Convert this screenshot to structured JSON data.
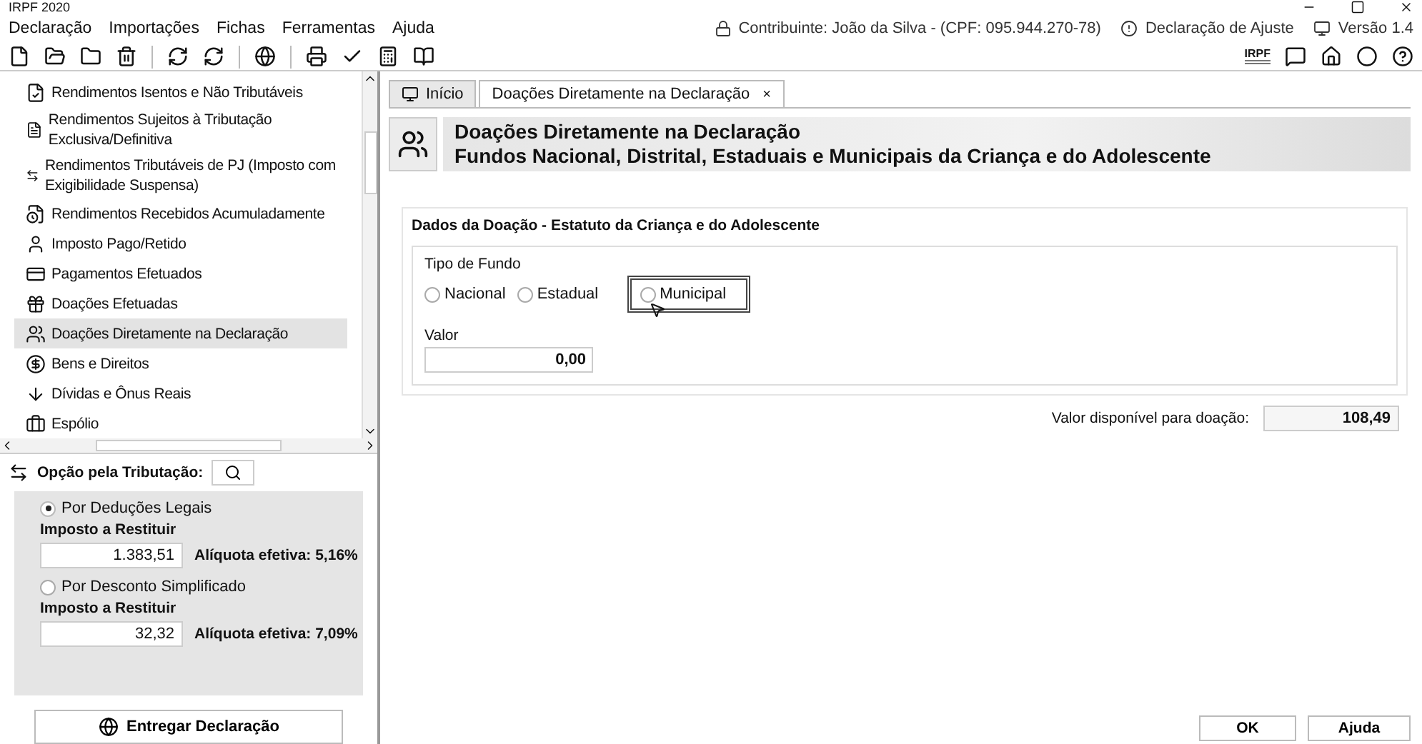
{
  "window": {
    "title": "IRPF 2020"
  },
  "menu": [
    "Declaração",
    "Importações",
    "Fichas",
    "Ferramentas",
    "Ajuda"
  ],
  "header_info": {
    "contribuinte": "Contribuinte: João da Silva - (CPF: 095.944.270-78)",
    "declaracao": "Declaração de Ajuste",
    "versao": "Versão 1.4"
  },
  "toolbar": {
    "logo": "IRPF"
  },
  "sidebar": {
    "items": [
      {
        "label": "Rendimentos Isentos e Não Tributáveis",
        "selected": false
      },
      {
        "label": "Rendimentos Sujeitos à Tributação Exclusiva/Definitiva",
        "selected": false
      },
      {
        "label": "Rendimentos Tributáveis de PJ (Imposto com Exigibilidade Suspensa)",
        "selected": false
      },
      {
        "label": "Rendimentos Recebidos Acumuladamente",
        "selected": false
      },
      {
        "label": "Imposto Pago/Retido",
        "selected": false
      },
      {
        "label": "Pagamentos Efetuados",
        "selected": false
      },
      {
        "label": "Doações Efetuadas",
        "selected": false
      },
      {
        "label": "Doações Diretamente na Declaração",
        "selected": true
      },
      {
        "label": "Bens e Direitos",
        "selected": false
      },
      {
        "label": "Dívidas e Ônus Reais",
        "selected": false
      },
      {
        "label": "Espólio",
        "selected": false
      }
    ]
  },
  "tax_option": {
    "label": "Opção pela Tributação:",
    "options": [
      {
        "label": "Por Deduções Legais",
        "selected": true,
        "field_label": "Imposto a Restituir",
        "value": "1.383,51",
        "rate": "Alíquota efetiva: 5,16%"
      },
      {
        "label": "Por Desconto Simplificado",
        "selected": false,
        "field_label": "Imposto a Restituir",
        "value": "32,32",
        "rate": "Alíquota efetiva: 7,09%"
      }
    ]
  },
  "deliver_button": "Entregar Declaração",
  "tabs": [
    {
      "label": "Início",
      "selected": false
    },
    {
      "label": "Doações Diretamente na Declaração",
      "selected": true,
      "close": "×"
    }
  ],
  "page_header": {
    "title": "Doações Diretamente na Declaração",
    "subtitle": "Fundos Nacional, Distrital, Estaduais e Municipais da Criança e do Adolescente"
  },
  "section": {
    "title": "Dados da Doação - Estatuto da Criança e do Adolescente",
    "fund_type_label": "Tipo de Fundo",
    "fund_types": [
      {
        "label": "Nacional",
        "selected": false,
        "focused": false
      },
      {
        "label": "Estadual",
        "selected": false,
        "focused": false
      },
      {
        "label": "Municipal",
        "selected": false,
        "focused": true
      }
    ],
    "value_label": "Valor",
    "value": "0,00"
  },
  "available": {
    "label": "Valor disponível para doação:",
    "value": "108,49"
  },
  "buttons": [
    "OK",
    "Ajuda"
  ]
}
